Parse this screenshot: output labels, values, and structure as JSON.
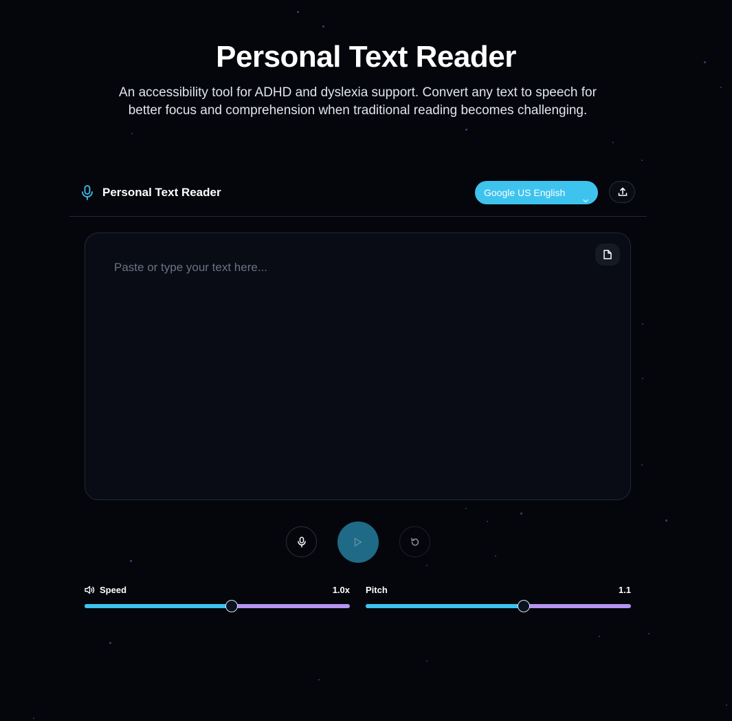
{
  "hero": {
    "title": "Personal Text Reader",
    "subtitle": "An accessibility tool for ADHD and dyslexia support. Convert any text to speech for better focus and comprehension when traditional reading becomes challenging."
  },
  "header": {
    "app_title": "Personal Text Reader",
    "voice_selected": "Google US English"
  },
  "editor": {
    "placeholder": "Paste or type your text here...",
    "value": ""
  },
  "sliders": {
    "speed": {
      "label": "Speed",
      "value_text": "1.0x",
      "level": 0.555
    },
    "pitch": {
      "label": "Pitch",
      "value_text": "1.1",
      "level": 0.595
    }
  },
  "colors": {
    "accent": "#3ec3ee",
    "slider_track": "#b593ee",
    "play_button": "#1f6a86",
    "background": "#05060b"
  },
  "icons": {
    "title": "microphone-icon",
    "voice_select": "chevron-down-icon",
    "upload": "upload-icon",
    "document": "document-icon",
    "record": "microphone-icon",
    "play": "play-icon",
    "reset": "rotate-ccw-icon",
    "speed": "volume-icon"
  }
}
